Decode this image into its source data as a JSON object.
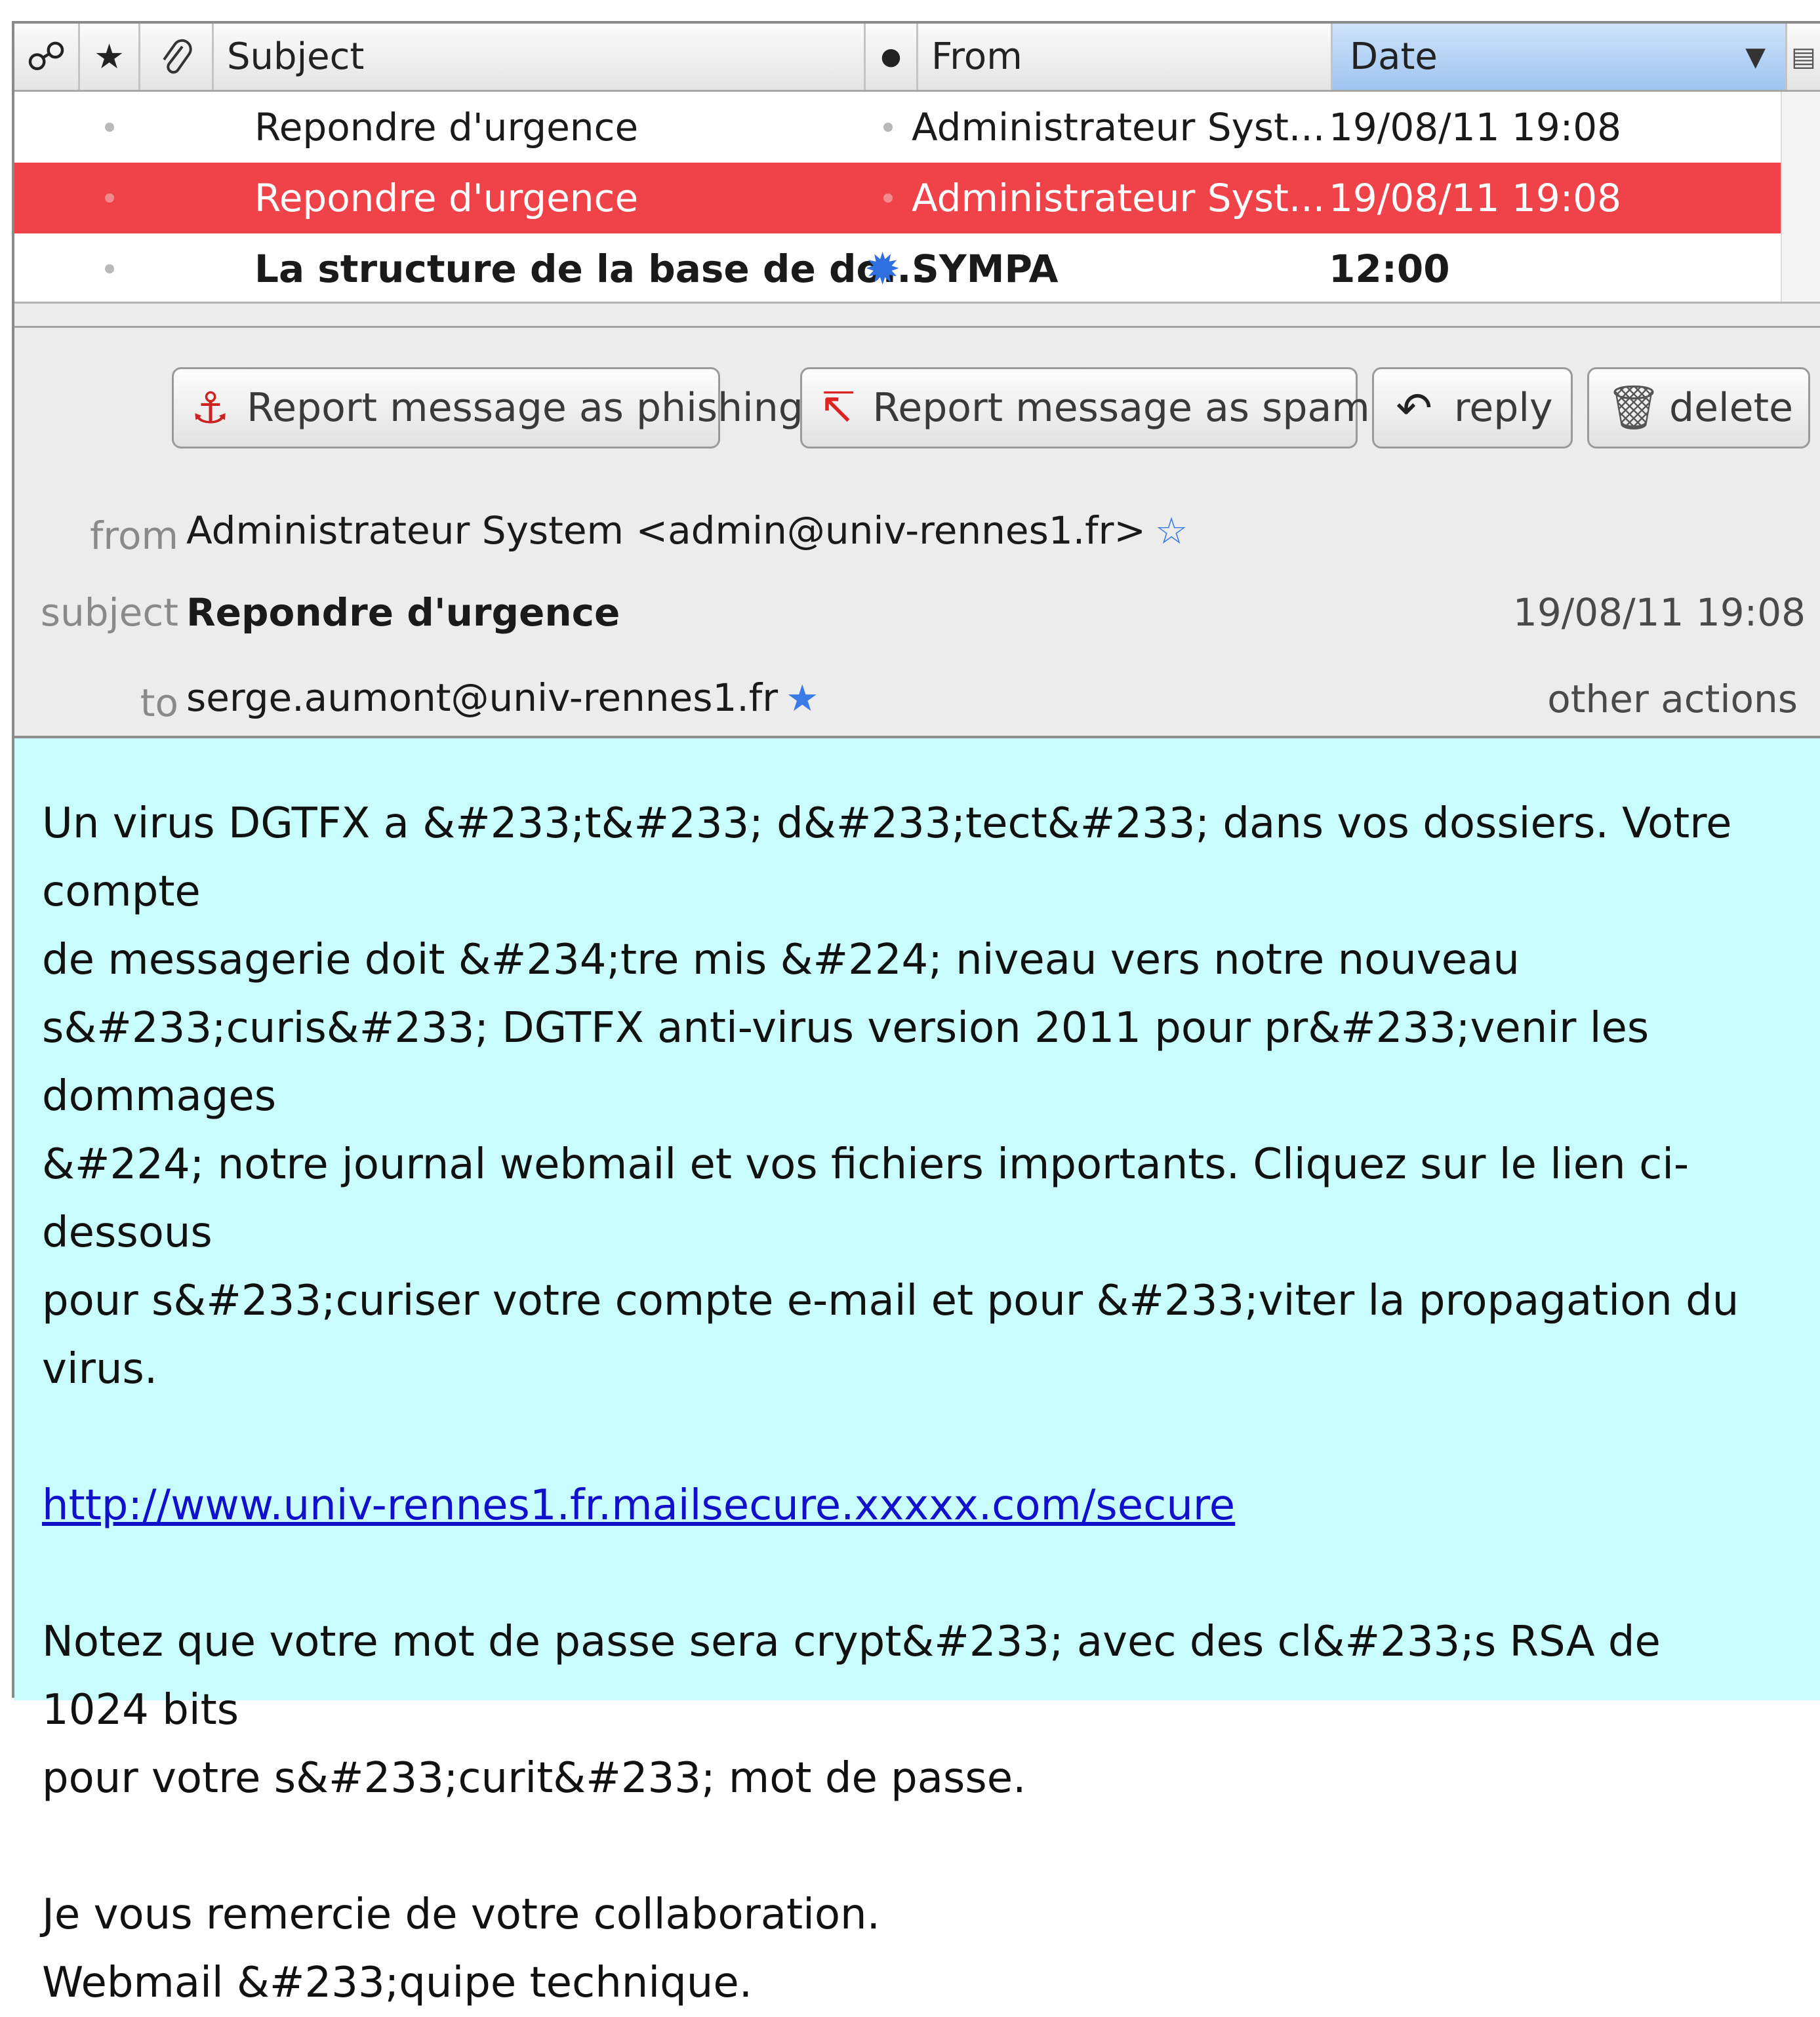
{
  "message_list": {
    "columns": {
      "thread_icon": "thread-icon",
      "star_icon": "star-icon",
      "attachment_icon": "paperclip-icon",
      "subject": "Subject",
      "read_icon": "read-status-icon",
      "from": "From",
      "date": "Date",
      "column_picker_icon": "column-picker-icon"
    },
    "rows": [
      {
        "subject": "Repondre d'urgence",
        "from": "Administrateur Syst...",
        "date": "19/08/11 19:08",
        "selected": false,
        "unread": false
      },
      {
        "subject": "Repondre d'urgence",
        "from": "Administrateur Syst...",
        "date": "19/08/11 19:08",
        "selected": true,
        "unread": false
      },
      {
        "subject": "La structure de la base de do...",
        "from": "SYMPA",
        "date": "12:00",
        "selected": false,
        "unread": true
      }
    ],
    "selected_row_color": "#ef4349"
  },
  "toolbar": {
    "phishing_label": "Report message as phishing",
    "spam_label": "Report message as spam",
    "reply_label": "reply",
    "delete_label": "delete"
  },
  "header": {
    "from_label": "from",
    "from_value": "Administrateur System <admin@univ-rennes1.fr>",
    "subject_label": "subject",
    "subject_value": "Repondre d'urgence",
    "date_value": "19/08/11 19:08",
    "to_label": "to",
    "to_value": "serge.aumont@univ-rennes1.fr",
    "other_actions": "other actions"
  },
  "body": {
    "paragraph1_line1": "Un virus DGTFX a &#233;t&#233; d&#233;tect&#233; dans vos dossiers. Votre compte",
    "paragraph1_line2": "de messagerie doit &#234;tre mis &#224; niveau vers notre nouveau",
    "paragraph1_line3": "s&#233;curis&#233; DGTFX anti-virus version 2011 pour pr&#233;venir les dommages",
    "paragraph1_line4": "&#224; notre journal webmail et vos fichiers importants. Cliquez sur le lien ci-dessous",
    "paragraph1_line5": "pour s&#233;curiser votre compte e-mail et pour &#233;viter la propagation du virus.",
    "link": "http://www.univ-rennes1.fr.mailsecure.xxxxx.com/secure",
    "paragraph2_line1": "Notez que votre mot de passe sera crypt&#233; avec des cl&#233;s RSA de 1024 bits",
    "paragraph2_line2": "pour votre s&#233;curit&#233; mot de passe.",
    "closing_line1": "Je vous remercie de votre collaboration.",
    "closing_line2": "Webmail &#233;quipe technique.",
    "background_color": "#c9fcfc"
  }
}
